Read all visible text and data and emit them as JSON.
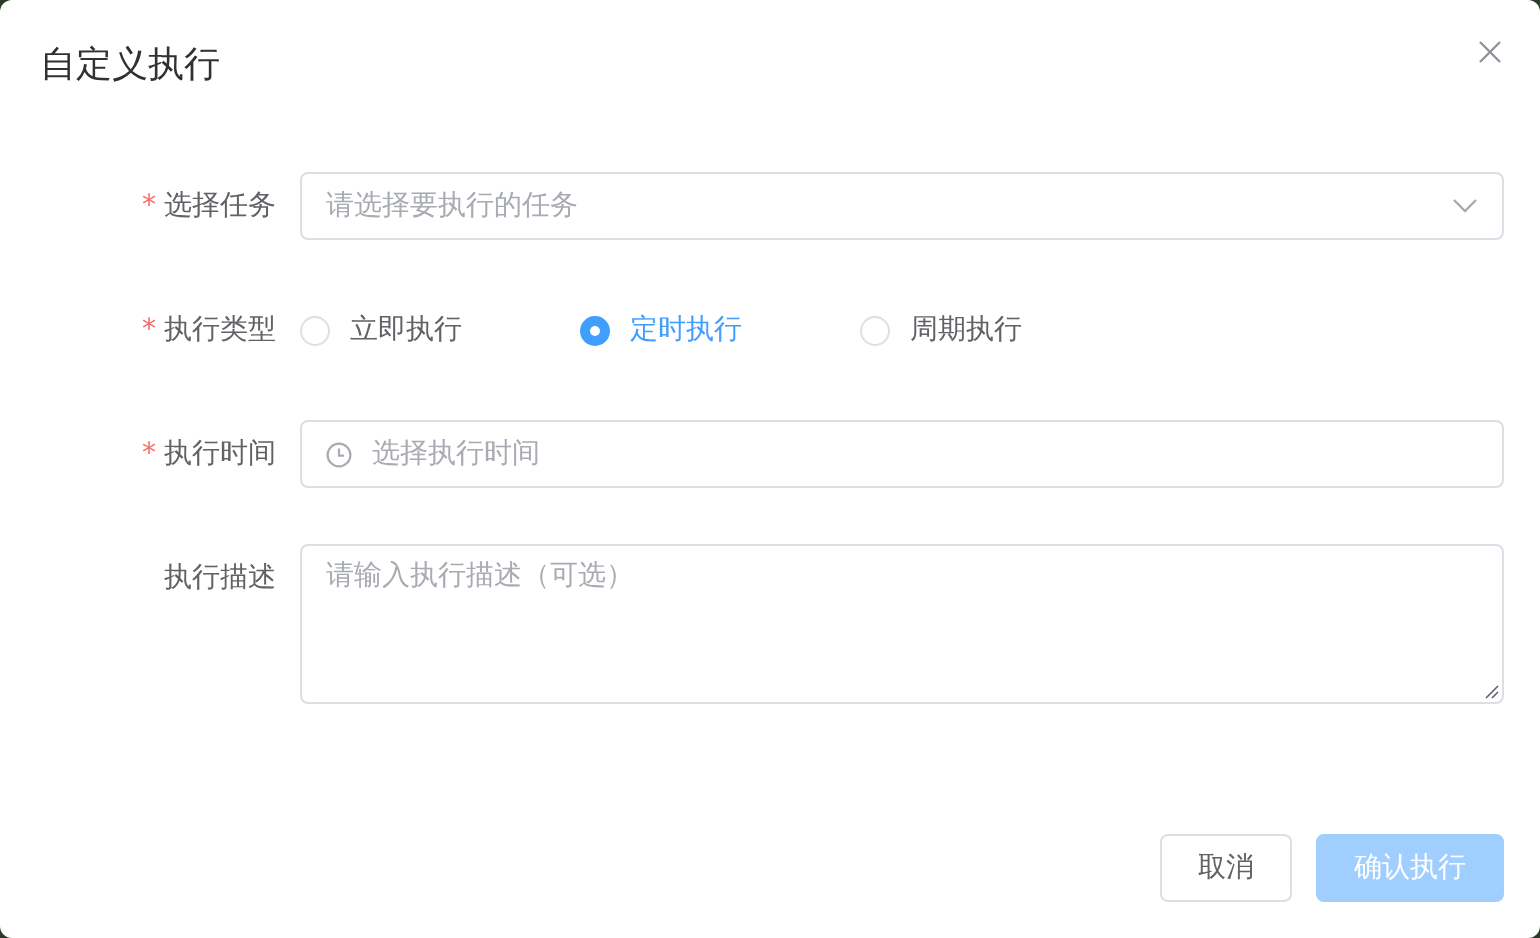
{
  "dialog": {
    "title": "自定义执行"
  },
  "fields": [
    {
      "kind": "select",
      "label": "选择任务",
      "required_mark": "*",
      "placeholder": "请选择要执行的任务"
    },
    {
      "kind": "radio",
      "label": "执行类型",
      "required_mark": "*",
      "options": [
        {
          "label": "立即执行",
          "selected": false
        },
        {
          "label": "定时执行",
          "selected": true
        },
        {
          "label": "周期执行",
          "selected": false
        }
      ]
    },
    {
      "kind": "time",
      "label": "执行时间",
      "required_mark": "*",
      "placeholder": "选择执行时间"
    },
    {
      "kind": "textarea",
      "label": "执行描述",
      "placeholder": "请输入执行描述（可选）"
    }
  ],
  "buttons": [
    {
      "label": "取消",
      "kind": "default",
      "disabled": false
    },
    {
      "label": "确认执行",
      "kind": "primary",
      "disabled": true
    }
  ]
}
